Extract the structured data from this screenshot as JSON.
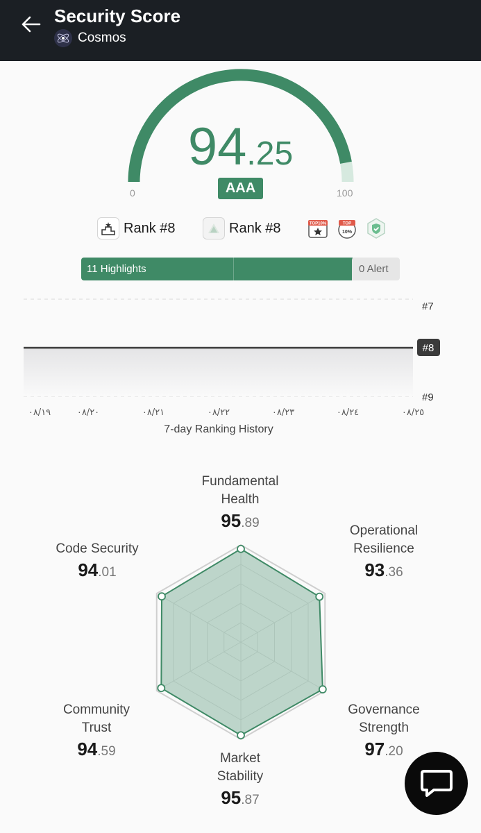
{
  "header": {
    "title": "Security Score",
    "project": "Cosmos"
  },
  "gauge": {
    "score_int": "94",
    "score_dec": ".25",
    "value": 94.25,
    "min_label": "0",
    "max_label": "100",
    "rating": "AAA"
  },
  "ranks": [
    {
      "label": "Rank #8",
      "icon": "podium-icon"
    },
    {
      "label": "Rank #8",
      "icon": "pyramid-icon"
    }
  ],
  "badges": [
    {
      "name": "top-10-percent-badge"
    },
    {
      "name": "top-10-percent-shield-badge"
    },
    {
      "name": "verified-shield-badge"
    }
  ],
  "highlights": {
    "highlights_label": "11 Highlights",
    "alert_label": "0 Alert"
  },
  "ranking_chart": {
    "title": "7-day Ranking History",
    "y_ticks": [
      "#7",
      "#8",
      "#9"
    ],
    "current": "#8",
    "x_labels": [
      "٠٨/١٩",
      "٠٨/٢٠",
      "٠٨/٢١",
      "٠٨/٢٢",
      "٠٨/٢٣",
      "٠٨/٢٤",
      "٠٨/٢٥"
    ]
  },
  "radar": {
    "categories": [
      {
        "label1": "Fundamental",
        "label2": "Health",
        "int": "95",
        "dec": ".89",
        "value": 95.89
      },
      {
        "label1": "Operational",
        "label2": "Resilience",
        "int": "93",
        "dec": ".36",
        "value": 93.36
      },
      {
        "label1": "Governance",
        "label2": "Strength",
        "int": "97",
        "dec": ".20",
        "value": 97.2
      },
      {
        "label1": "Market",
        "label2": "Stability",
        "int": "95",
        "dec": ".87",
        "value": 95.87
      },
      {
        "label1": "Community",
        "label2": "Trust",
        "int": "94",
        "dec": ".59",
        "value": 94.59
      },
      {
        "label1": "Code Security",
        "label2": "",
        "int": "94",
        "dec": ".01",
        "value": 94.01
      }
    ]
  },
  "colors": {
    "accent": "#3f8a66",
    "header_bg": "#1b1f24"
  }
}
